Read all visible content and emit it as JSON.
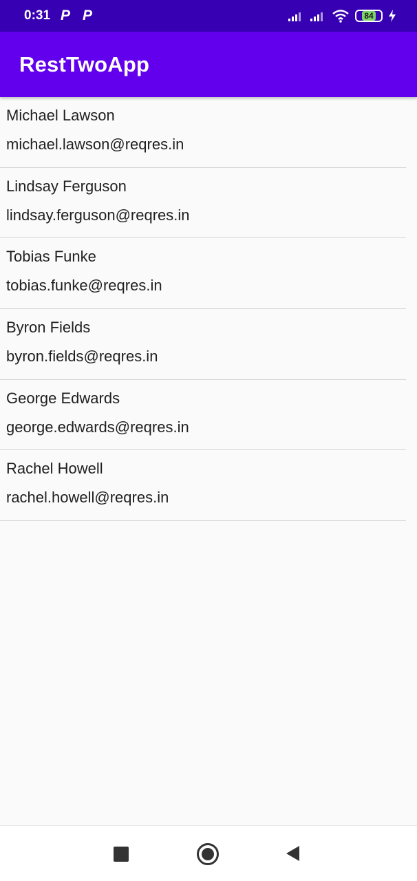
{
  "status_bar": {
    "time": "0:31",
    "notification_icons": [
      "P",
      "P"
    ],
    "battery_level": "84"
  },
  "app_bar": {
    "title": "RestTwoApp"
  },
  "users": [
    {
      "name": "Michael Lawson",
      "email": "michael.lawson@reqres.in"
    },
    {
      "name": "Lindsay Ferguson",
      "email": "lindsay.ferguson@reqres.in"
    },
    {
      "name": "Tobias Funke",
      "email": "tobias.funke@reqres.in"
    },
    {
      "name": "Byron Fields",
      "email": "byron.fields@reqres.in"
    },
    {
      "name": "George Edwards",
      "email": "george.edwards@reqres.in"
    },
    {
      "name": "Rachel Howell",
      "email": "rachel.howell@reqres.in"
    }
  ],
  "colors": {
    "status_bar": "#3700b3",
    "app_bar": "#6200ee",
    "background": "#fafafa",
    "divider": "#d6d6d6"
  },
  "icons": {
    "nav_recents": "square-stop-icon",
    "nav_home": "circle-home-icon",
    "nav_back": "triangle-back-icon"
  }
}
